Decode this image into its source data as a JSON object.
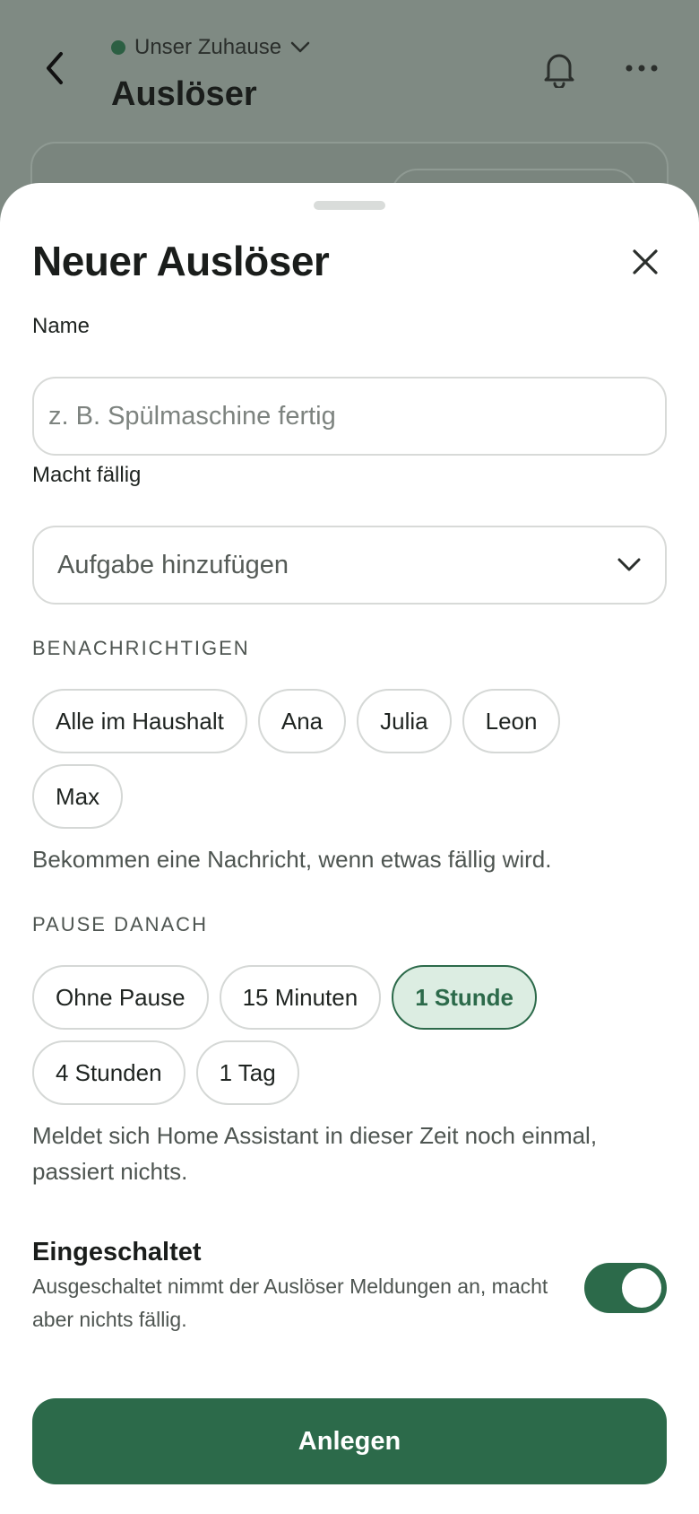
{
  "background_page": {
    "household_label": "Unser Zuhause",
    "title": "Auslöser"
  },
  "sheet": {
    "title": "Neuer Auslöser",
    "name_field": {
      "label": "Name",
      "placeholder": "z. B. Spülmaschine fertig",
      "value": ""
    },
    "task_field": {
      "label": "Macht fällig",
      "value": "Aufgabe hinzufügen"
    },
    "notify": {
      "label": "BENACHRICHTIGEN",
      "options": [
        "Alle im Haushalt",
        "Ana",
        "Julia",
        "Leon",
        "Max"
      ],
      "hint": "Bekommen eine Nachricht, wenn etwas fällig wird."
    },
    "pause": {
      "label": "PAUSE DANACH",
      "options": [
        "Ohne Pause",
        "15 Minuten",
        "1 Stunde",
        "4 Stunden",
        "1 Tag"
      ],
      "selected": "1 Stunde",
      "hint": "Meldet sich Home Assistant in dieser Zeit noch einmal, passiert nichts."
    },
    "enabled": {
      "title": "Eingeschaltet",
      "description": "Ausgeschaltet nimmt der Auslöser Meldungen an, macht aber nichts fällig.",
      "on": true
    },
    "submit_label": "Anlegen"
  },
  "colors": {
    "accent": "#2c6a4a",
    "accent_light": "#dcede2",
    "overlay": "#7f8a83"
  },
  "icons": {
    "back": "chevron-left-icon",
    "household": "chevron-down-icon",
    "notifications": "bell-icon",
    "more": "more-horizontal-icon",
    "close": "close-icon",
    "select": "chevron-down-icon"
  }
}
